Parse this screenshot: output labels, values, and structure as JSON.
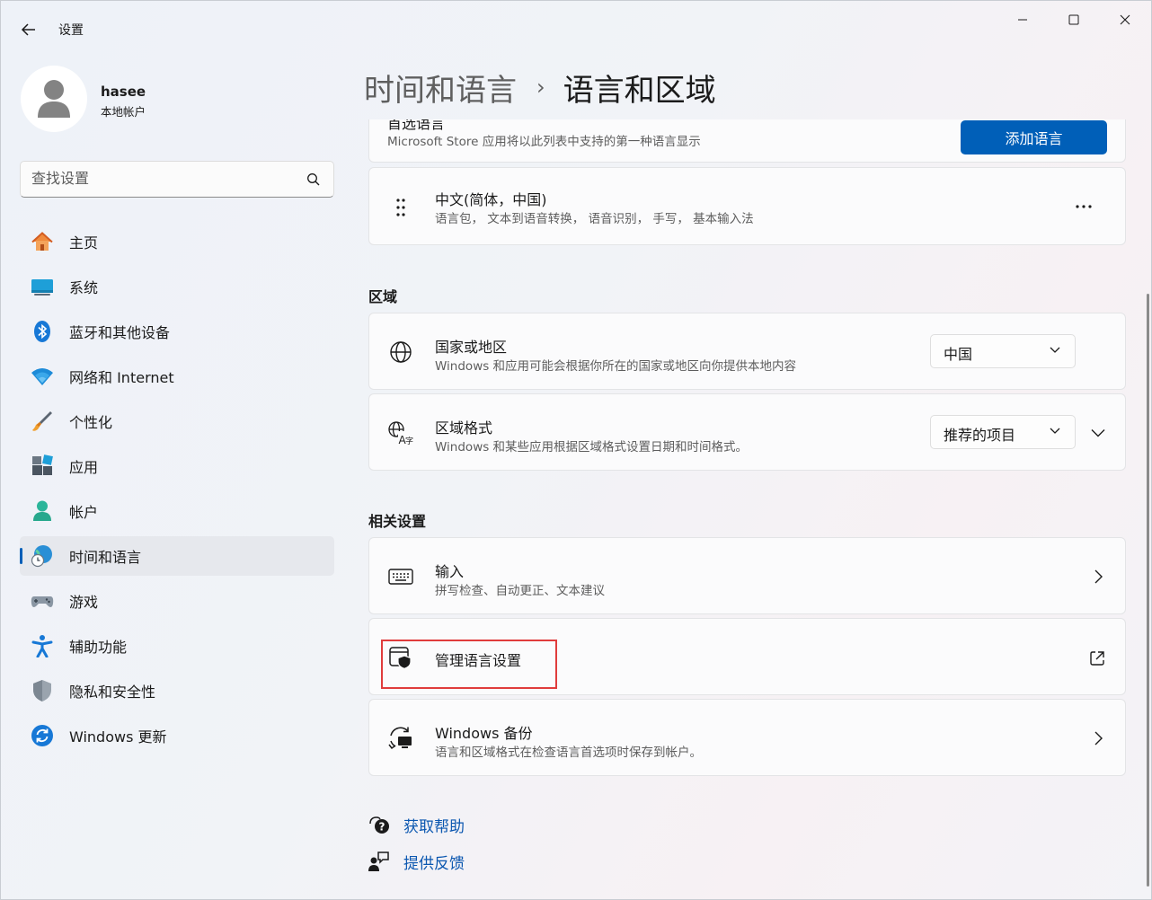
{
  "window": {
    "title": "设置",
    "controls": {
      "minimize": "minimize",
      "maximize": "maximize",
      "close": "close"
    }
  },
  "user": {
    "name": "hasee",
    "account_type": "本地帐户"
  },
  "search": {
    "placeholder": "查找设置"
  },
  "sidebar": {
    "items": [
      {
        "label": "主页",
        "icon": "home-icon"
      },
      {
        "label": "系统",
        "icon": "system-icon"
      },
      {
        "label": "蓝牙和其他设备",
        "icon": "bluetooth-icon"
      },
      {
        "label": "网络和 Internet",
        "icon": "wifi-icon"
      },
      {
        "label": "个性化",
        "icon": "brush-icon"
      },
      {
        "label": "应用",
        "icon": "apps-icon"
      },
      {
        "label": "帐户",
        "icon": "account-icon"
      },
      {
        "label": "时间和语言",
        "icon": "time-language-icon",
        "active": true
      },
      {
        "label": "游戏",
        "icon": "gamepad-icon"
      },
      {
        "label": "辅助功能",
        "icon": "accessibility-icon"
      },
      {
        "label": "隐私和安全性",
        "icon": "shield-icon"
      },
      {
        "label": "Windows 更新",
        "icon": "windows-update-icon"
      }
    ]
  },
  "header": {
    "parent": "时间和语言",
    "separator": "›",
    "current": "语言和区域"
  },
  "preferred_languages": {
    "title_partial": "首选语言",
    "subtitle": "Microsoft Store 应用将以此列表中支持的第一种语言显示",
    "add_button": "添加语言",
    "languages": [
      {
        "name": "中文(简体，中国)",
        "features": "语言包， 文本到语音转换， 语音识别， 手写， 基本输入法"
      }
    ]
  },
  "region": {
    "heading": "区域",
    "country": {
      "title": "国家或地区",
      "subtitle": "Windows 和应用可能会根据你所在的国家或地区向你提供本地内容",
      "value": "中国"
    },
    "format": {
      "title": "区域格式",
      "subtitle": "Windows 和某些应用根据区域格式设置日期和时间格式。",
      "value": "推荐的项目"
    }
  },
  "related": {
    "heading": "相关设置",
    "typing": {
      "title": "输入",
      "subtitle": "拼写检查、自动更正、文本建议"
    },
    "admin": {
      "title": "管理语言设置"
    },
    "backup": {
      "title": "Windows 备份",
      "subtitle": "语言和区域格式在检查语言首选项时保存到帐户。"
    }
  },
  "help": {
    "get_help": "获取帮助",
    "feedback": "提供反馈"
  },
  "colors": {
    "accent": "#005fb8",
    "highlight_border": "#e03c3c",
    "link": "#0b57b0"
  }
}
